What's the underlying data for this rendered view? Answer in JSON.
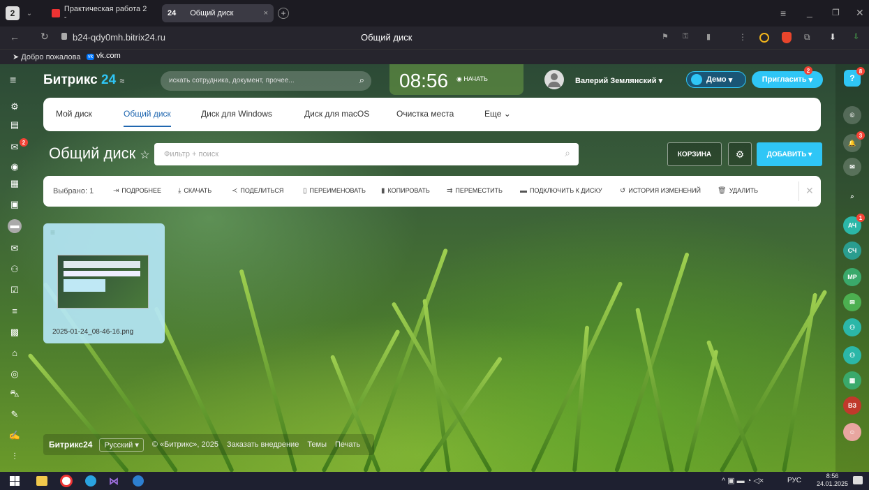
{
  "browser": {
    "profile": "2",
    "tabs": [
      {
        "label": "Практическая работа 2 -"
      },
      {
        "label": "Общий диск",
        "count": "24"
      }
    ],
    "url": "b24-qdy0mh.bitrix24.ru",
    "page_title": "Общий диск",
    "bookmarks": [
      {
        "label": "Добро пожалова"
      },
      {
        "label": "vk.com"
      }
    ]
  },
  "header": {
    "logo_main": "Битрикс",
    "logo_num": "24",
    "search_placeholder": "искать сотрудника, документ, прочее...",
    "time": "08:56",
    "start_label": "НАЧАТЬ",
    "user_name": "Валерий Землянский",
    "demo_label": "Демо",
    "invite_label": "Пригласить",
    "invite_badge": "2",
    "help_badge": "8"
  },
  "disk_tabs": [
    "Мой диск",
    "Общий диск",
    "Диск для Windows",
    "Диск для macOS",
    "Очистка места",
    "Еще"
  ],
  "disk_tabs_active": 1,
  "page": {
    "title": "Общий диск",
    "filter_placeholder": "Фильтр + поиск",
    "trash_label": "КОРЗИНА",
    "add_label": "ДОБАВИТЬ"
  },
  "toolbar": {
    "selected": "Выбрано: 1",
    "actions": [
      "ПОДРОБНЕЕ",
      "СКАЧАТЬ",
      "ПОДЕЛИТЬСЯ",
      "ПЕРЕИМЕНОВАТЬ",
      "КОПИРОВАТЬ",
      "ПЕРЕМЕСТИТЬ",
      "ПОДКЛЮЧИТЬ К ДИСКУ",
      "ИСТОРИЯ ИЗМЕНЕНИЙ",
      "УДАЛИТЬ"
    ]
  },
  "file": {
    "name": "2025-01-24_08-46-16.png"
  },
  "footer": {
    "logo": "Битрикс24",
    "lang": "Русский",
    "copyright": "© «Битрикс», 2025",
    "order": "Заказать внедрение",
    "themes": "Темы",
    "print": "Печать"
  },
  "right_avatars": [
    {
      "initials": "АЧ",
      "color": "#2bb7a8",
      "badge": "1"
    },
    {
      "initials": "СЧ",
      "color": "#2a9d8f"
    },
    {
      "initials": "МР",
      "color": "#3aa96b"
    },
    {
      "initials": "ВЗ",
      "color": "#c0392b"
    }
  ],
  "left_badges": {
    "chat": "2"
  },
  "right_badges": {
    "bell": "3"
  },
  "taskbar": {
    "lang": "РУС",
    "time": "8:56",
    "date": "24.01.2025"
  },
  "colors": {
    "accent": "#2fc6f6",
    "invite": "#2fc6f6",
    "active_tab": "#2067b0"
  }
}
